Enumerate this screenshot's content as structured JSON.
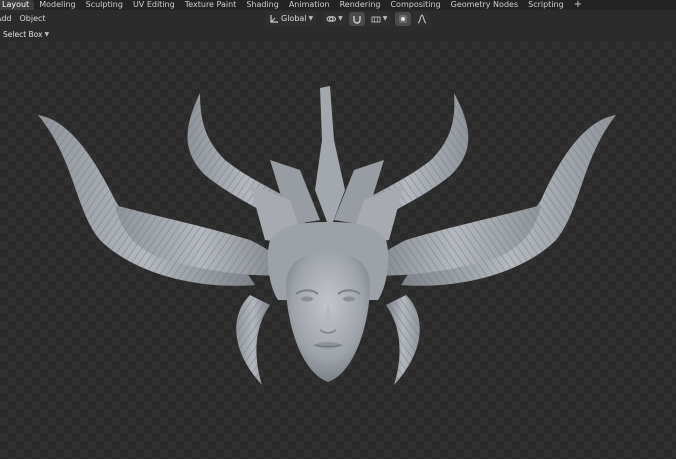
{
  "workspace_tabs": [
    {
      "label": "Layout",
      "active": true
    },
    {
      "label": "Modeling",
      "active": false
    },
    {
      "label": "Sculpting",
      "active": false
    },
    {
      "label": "UV Editing",
      "active": false
    },
    {
      "label": "Texture Paint",
      "active": false
    },
    {
      "label": "Shading",
      "active": false
    },
    {
      "label": "Animation",
      "active": false
    },
    {
      "label": "Rendering",
      "active": false
    },
    {
      "label": "Compositing",
      "active": false
    },
    {
      "label": "Geometry Nodes",
      "active": false
    },
    {
      "label": "Scripting",
      "active": false
    }
  ],
  "add_workspace": "+",
  "header": {
    "menu_add": "Add",
    "menu_object": "Object",
    "transform_orientation": "Global"
  },
  "subbar": {
    "select_mode": "Select Box"
  },
  "icons": {
    "orientation": "transform-axes-icon",
    "pivot": "link-icon",
    "snap": "magnet-icon",
    "snap_increment": "grid-snap-icon",
    "proportional": "proportional-edit-icon",
    "falloff": "falloff-curve-icon"
  },
  "colors": {
    "topbar_bg": "#232323",
    "header_bg": "#2b2b2b",
    "viewport_checker_dark": "#2a2a2a",
    "viewport_checker_light": "#313131",
    "sculpt_color": "#a9adb4"
  }
}
